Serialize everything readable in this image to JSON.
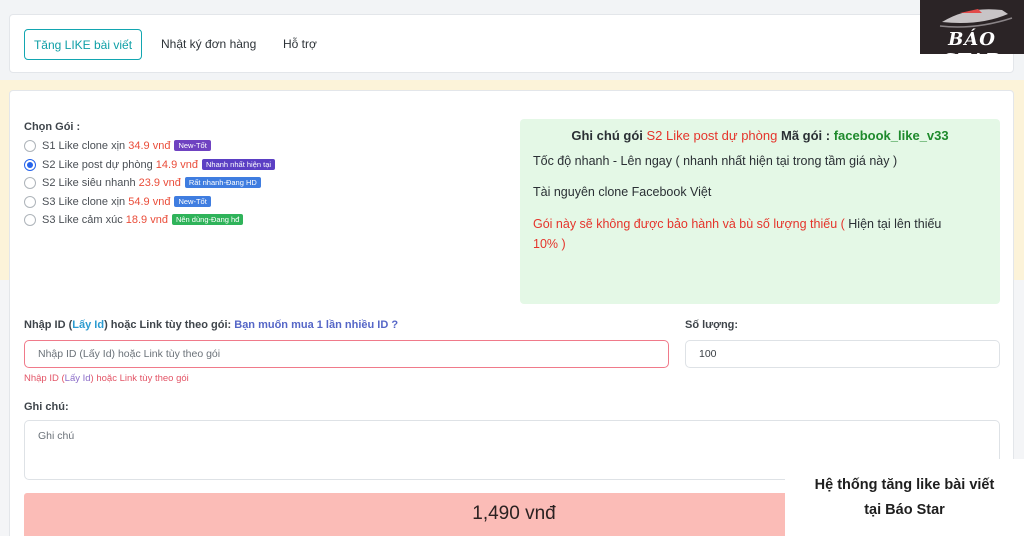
{
  "nav": {
    "tabs": [
      {
        "label": "Tăng LIKE bài viết"
      },
      {
        "label": "Nhật ký đơn hàng"
      },
      {
        "label": "Hỗ trợ"
      }
    ]
  },
  "logo": {
    "text": "BÁO STAR"
  },
  "packages": {
    "label": "Chọn Gói :",
    "selected_index": 1,
    "items": [
      {
        "name": "S1 Like clone xịn",
        "price": "34.9 vnđ",
        "badge": "New-Tốt",
        "badge_color": "#6f42c1"
      },
      {
        "name": "S2 Like post dự phòng",
        "price": "14.9 vnđ",
        "badge": "Nhanh nhất hiện tại",
        "badge_color": "#5b3fc4"
      },
      {
        "name": "S2 Like siêu nhanh",
        "price": "23.9 vnđ",
        "badge": "Rất nhanh-Đang HD",
        "badge_color": "#3f7de0"
      },
      {
        "name": "S3 Like clone xịn",
        "price": "54.9 vnđ",
        "badge": "New-Tốt",
        "badge_color": "#3f7de0"
      },
      {
        "name": "S3 Like cảm xúc",
        "price": "18.9 vnđ",
        "badge": "Nên dùng-Đang hđ",
        "badge_color": "#2fb35a"
      }
    ]
  },
  "note": {
    "title_prefix": "Ghi chú gói",
    "package_name": "S2 Like post dự phòng",
    "code_label": "Mã gói :",
    "code_value": "facebook_like_v33",
    "line1": "Tốc độ nhanh - Lên ngay ( nhanh nhất hiện tại trong tầm giá này )",
    "line2": "Tài nguyên clone Facebook Việt",
    "warning_red": "Gói này sẽ không được bảo hành và bù số lượng thiếu (",
    "warning_rest": " Hiện tại lên thiếu",
    "warning_line2": "10% )",
    "colors": {
      "red": "#e5342b",
      "green": "#1e8a2c"
    }
  },
  "id_input": {
    "label_prefix": "Nhập ID (",
    "label_link": "Lấy Id",
    "label_suffix": ") hoặc Link tùy theo gói:",
    "label_question": "Bạn muốn mua 1 lần nhiều ID ?",
    "placeholder": "Nhập ID (Lấy Id) hoặc Link tùy theo gói",
    "error_prefix": "Nhập ID (",
    "error_link": "Lấy Id",
    "error_suffix": ") hoặc Link tùy theo gói"
  },
  "quantity": {
    "label": "Số lượng:",
    "value": "100"
  },
  "notes_field": {
    "label": "Ghi chú:",
    "placeholder": "Ghi chú"
  },
  "total": {
    "text": "1,490 vnđ"
  },
  "caption": {
    "line1": "Hệ thống tăng like bài viết",
    "line2": "tại Báo Star"
  }
}
